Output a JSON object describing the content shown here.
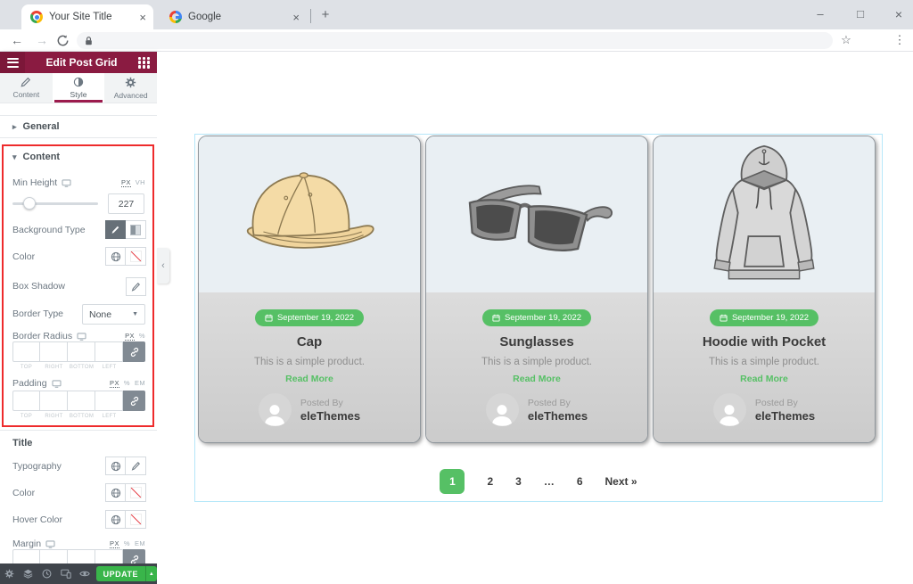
{
  "browser": {
    "tabs": [
      {
        "title": "Your Site Title"
      },
      {
        "title": "Google"
      }
    ],
    "window_controls": {
      "minimize": "–",
      "maximize": "□",
      "close": "×"
    }
  },
  "glyphs": {
    "tab_close": "×",
    "new_tab": "+",
    "back": "←",
    "forward": "→",
    "star": "☆",
    "kebab": "⋮",
    "caret_right": "▸",
    "caret_down": "▾",
    "select_caret": "▼",
    "update_caret": "▲",
    "collapse": "‹"
  },
  "panel": {
    "header": {
      "title": "Edit Post Grid"
    },
    "tabs": [
      {
        "label": "Content"
      },
      {
        "label": "Style"
      },
      {
        "label": "Advanced"
      }
    ],
    "general_section": {
      "label": "General"
    },
    "content_section": {
      "label": "Content",
      "min_height": {
        "label": "Min Height",
        "units": [
          "PX",
          "VH"
        ],
        "value": "227"
      },
      "background_type": {
        "label": "Background Type"
      },
      "color": {
        "label": "Color"
      },
      "box_shadow": {
        "label": "Box Shadow"
      },
      "border_type": {
        "label": "Border Type",
        "value": "None"
      },
      "border_radius": {
        "label": "Border Radius",
        "units": [
          "PX",
          "%"
        ],
        "sides": [
          "TOP",
          "RIGHT",
          "BOTTOM",
          "LEFT"
        ],
        "values": [
          "",
          "",
          "",
          ""
        ]
      },
      "padding": {
        "label": "Padding",
        "units": [
          "PX",
          "%",
          "EM"
        ],
        "sides": [
          "TOP",
          "RIGHT",
          "BOTTOM",
          "LEFT"
        ],
        "values": [
          "",
          "",
          "",
          ""
        ]
      }
    },
    "title_section": {
      "label": "Title",
      "typography": {
        "label": "Typography"
      },
      "color": {
        "label": "Color"
      },
      "hover_color": {
        "label": "Hover Color"
      },
      "margin": {
        "label": "Margin",
        "units": [
          "PX",
          "%",
          "EM"
        ],
        "values": [
          "",
          "",
          "",
          ""
        ]
      }
    },
    "footer": {
      "update_label": "UPDATE"
    }
  },
  "canvas": {
    "cards": [
      {
        "date": "September 19, 2022",
        "title": "Cap",
        "description": "This is a simple product.",
        "read_more": "Read More",
        "posted_by": "Posted By",
        "author": "eleThemes",
        "image": "cap-illustration"
      },
      {
        "date": "September 19, 2022",
        "title": "Sunglasses",
        "description": "This is a simple product.",
        "read_more": "Read More",
        "posted_by": "Posted By",
        "author": "eleThemes",
        "image": "sunglasses-illustration"
      },
      {
        "date": "September 19, 2022",
        "title": "Hoodie with Pocket",
        "description": "This is a simple product.",
        "read_more": "Read More",
        "posted_by": "Posted By",
        "author": "eleThemes",
        "image": "hoodie-illustration"
      }
    ],
    "pagination": {
      "pages": [
        "1",
        "2",
        "3",
        "…",
        "6"
      ],
      "active_page": "1",
      "next_label": "Next »"
    }
  },
  "colors": {
    "panel_header": "#8a1b41",
    "tab_underline": "#9c1b4d",
    "annotation_red": "#ee2b2c",
    "badge_green": "#56c065",
    "update_green": "#39b54a",
    "section_outline": "#b5e7f9"
  }
}
